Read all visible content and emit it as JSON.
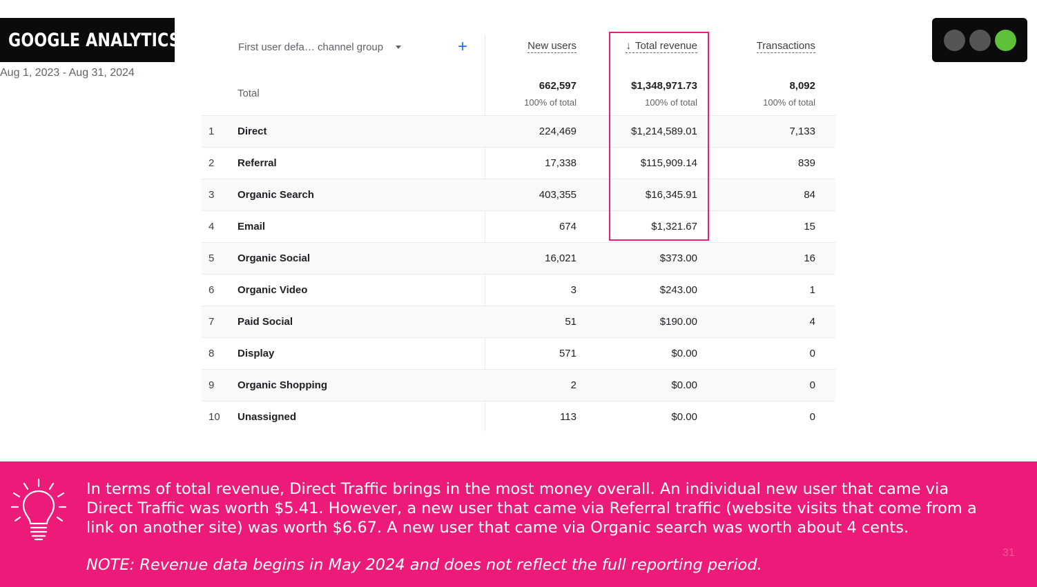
{
  "slide": {
    "title": "GOOGLE ANALYTICS",
    "date_range": "Aug 1, 2023 - Aug 31, 2024",
    "page_number": "31"
  },
  "window_dots": {
    "colors": [
      "#555555",
      "#555555",
      "#5ec13a"
    ]
  },
  "table": {
    "dimension_label": "First user defa… channel group",
    "add_label": "+",
    "columns": {
      "new_users": "New users",
      "total_revenue": "Total revenue",
      "transactions": "Transactions"
    },
    "sort_indicator": "↓",
    "total": {
      "label": "Total",
      "new_users": "662,597",
      "total_revenue": "$1,348,971.73",
      "transactions": "8,092",
      "pct": "100% of total"
    },
    "rows": [
      {
        "idx": "1",
        "name": "Direct",
        "new_users": "224,469",
        "revenue": "$1,214,589.01",
        "transactions": "7,133"
      },
      {
        "idx": "2",
        "name": "Referral",
        "new_users": "17,338",
        "revenue": "$115,909.14",
        "transactions": "839"
      },
      {
        "idx": "3",
        "name": "Organic Search",
        "new_users": "403,355",
        "revenue": "$16,345.91",
        "transactions": "84"
      },
      {
        "idx": "4",
        "name": "Email",
        "new_users": "674",
        "revenue": "$1,321.67",
        "transactions": "15"
      },
      {
        "idx": "5",
        "name": "Organic Social",
        "new_users": "16,021",
        "revenue": "$373.00",
        "transactions": "16"
      },
      {
        "idx": "6",
        "name": "Organic Video",
        "new_users": "3",
        "revenue": "$243.00",
        "transactions": "1"
      },
      {
        "idx": "7",
        "name": "Paid Social",
        "new_users": "51",
        "revenue": "$190.00",
        "transactions": "4"
      },
      {
        "idx": "8",
        "name": "Display",
        "new_users": "571",
        "revenue": "$0.00",
        "transactions": "0"
      },
      {
        "idx": "9",
        "name": "Organic Shopping",
        "new_users": "2",
        "revenue": "$0.00",
        "transactions": "0"
      },
      {
        "idx": "10",
        "name": "Unassigned",
        "new_users": "113",
        "revenue": "$0.00",
        "transactions": "0"
      }
    ]
  },
  "highlight_color": "#e91e79",
  "banner": {
    "color": "#ec1a78",
    "text": "In terms of total revenue, Direct Traffic brings in the most money overall. An individual new user that came via Direct Traffic was worth $5.41. However, a new user that came via Referral traffic (website visits that come from a link on another site) was worth $6.67. A new user that came via Organic search was worth about 4 cents.",
    "note": "NOTE: Revenue data begins in May 2024 and does not reflect the full reporting period.",
    "icon": "lightbulb-icon"
  }
}
